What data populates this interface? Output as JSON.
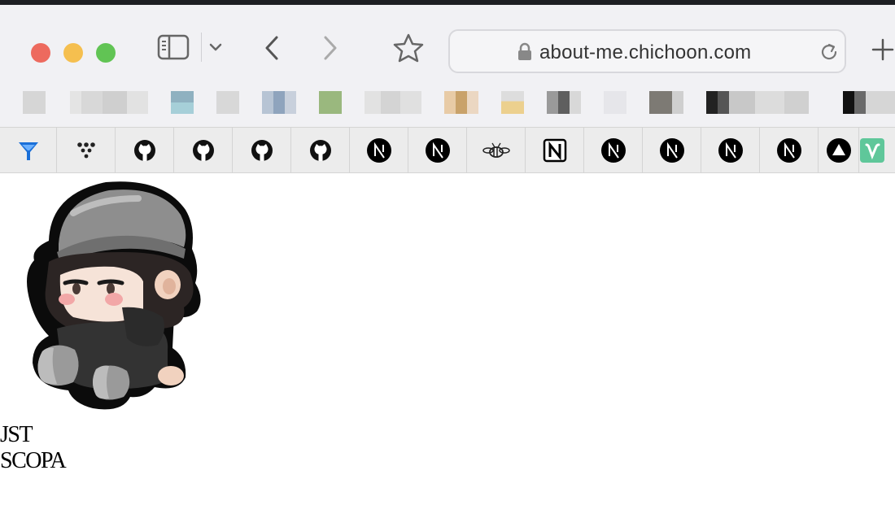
{
  "browser": {
    "url": "about-me.chichoon.com",
    "icons": {
      "sidebar": "sidebar-icon",
      "dropdown": "chevron-down-icon",
      "back": "back-arrow-icon",
      "forward": "forward-arrow-icon",
      "bookmark": "star-icon",
      "lock": "lock-icon",
      "reload": "reload-icon",
      "new_tab": "plus-icon"
    }
  },
  "extensions": [
    {
      "name": "filter-icon",
      "color": "#1a6fd8"
    },
    {
      "name": "dots-logo-icon"
    },
    {
      "name": "github-icon"
    },
    {
      "name": "github-icon"
    },
    {
      "name": "github-icon"
    },
    {
      "name": "github-icon"
    },
    {
      "name": "nextjs-icon"
    },
    {
      "name": "nextjs-icon"
    },
    {
      "name": "bee-icon"
    },
    {
      "name": "notion-icon"
    },
    {
      "name": "nextjs-icon"
    },
    {
      "name": "nextjs-icon"
    },
    {
      "name": "nextjs-icon"
    },
    {
      "name": "nextjs-icon"
    },
    {
      "name": "vercel-icon"
    },
    {
      "name": "vue-icon",
      "color": "#5fc79a"
    }
  ],
  "page": {
    "names": [
      "JST",
      "SCOPA"
    ]
  }
}
